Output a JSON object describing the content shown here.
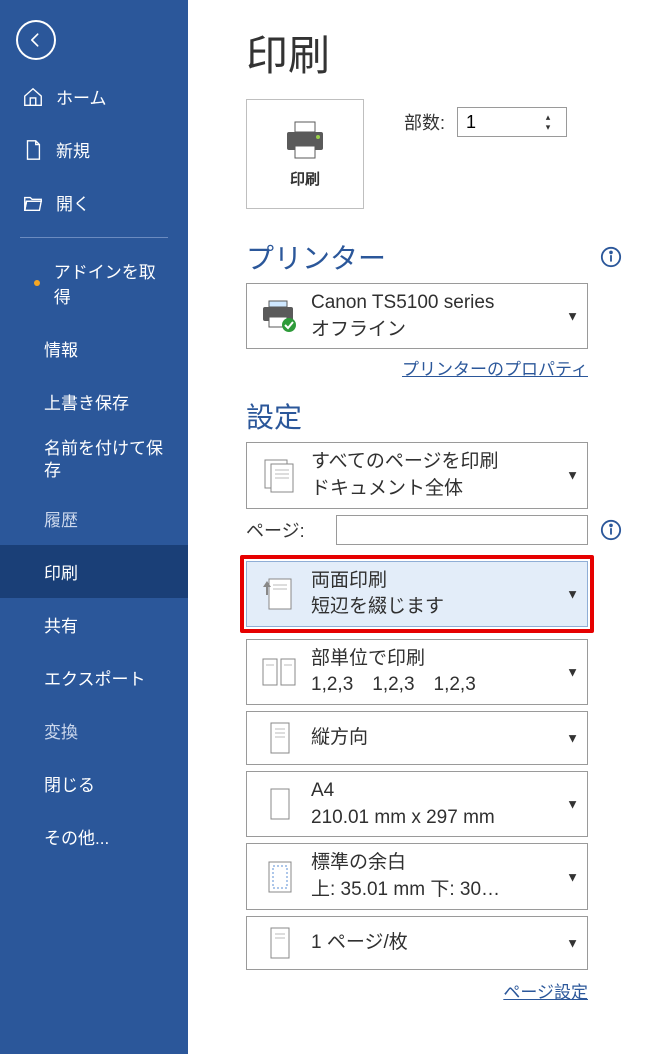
{
  "sidebar": {
    "home": "ホーム",
    "new": "新規",
    "open": "開く",
    "addins": "アドインを取得",
    "info": "情報",
    "overwrite": "上書き保存",
    "saveas": "名前を付けて保存",
    "history": "履歴",
    "print": "印刷",
    "share": "共有",
    "export": "エクスポート",
    "transform": "変換",
    "close": "閉じる",
    "others": "その他..."
  },
  "title": "印刷",
  "print_button": "印刷",
  "copies": {
    "label": "部数:",
    "value": "1"
  },
  "printer_section": "プリンター",
  "printer": {
    "name": "Canon TS5100 series",
    "status": "オフライン"
  },
  "printer_props_link": "プリンターのプロパティ",
  "settings_section": "設定",
  "pages_label": "ページ:",
  "pages_value": "",
  "sel_scope": {
    "line1": "すべてのページを印刷",
    "line2": "ドキュメント全体"
  },
  "sel_duplex": {
    "line1": "両面印刷",
    "line2": "短辺を綴じます"
  },
  "sel_collate": {
    "line1": "部単位で印刷",
    "line2": "1,2,3　1,2,3　1,2,3"
  },
  "sel_orient": {
    "line1": "縦方向"
  },
  "sel_paper": {
    "line1": "A4",
    "line2": "210.01 mm x 297 mm"
  },
  "sel_margin": {
    "line1": "標準の余白",
    "line2": "上: 35.01 mm 下: 30…"
  },
  "sel_ppp": {
    "line1": "1 ページ/枚"
  },
  "page_setup_link": "ページ設定"
}
